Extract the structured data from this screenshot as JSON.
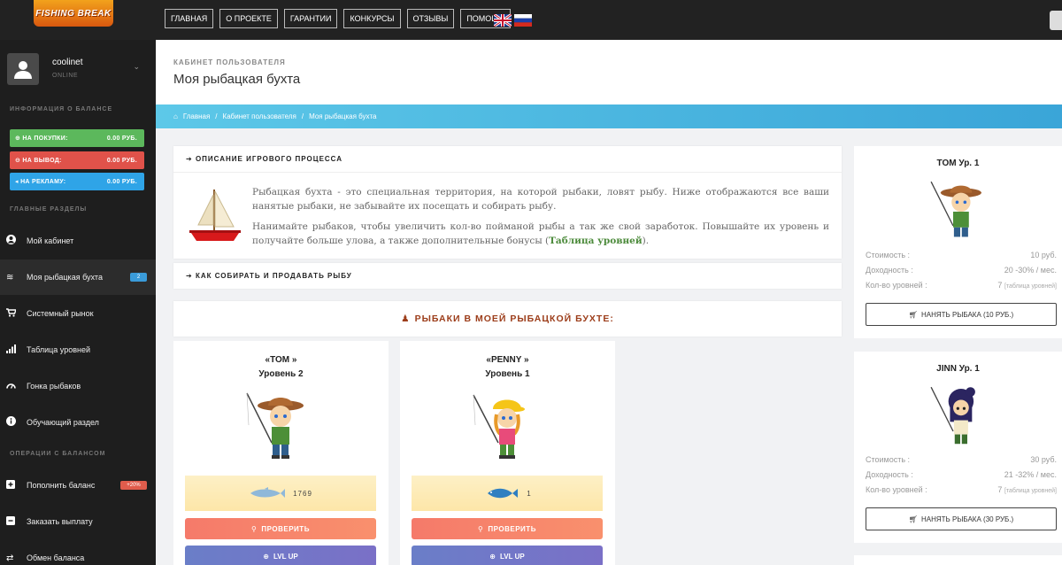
{
  "logo": {
    "text": "FISHING BREAK"
  },
  "nav": [
    "ГЛАВНАЯ",
    "О ПРОЕКТЕ",
    "ГАРАНТИИ",
    "КОНКУРСЫ",
    "ОТЗЫВЫ",
    "ПОМОЩЬ"
  ],
  "user": {
    "name": "coolinet",
    "status": "ONLINE"
  },
  "sidebar": {
    "balance_header": "ИНФОРМАЦИЯ О БАЛАНСЕ",
    "balances": [
      {
        "label": "НА ПОКУПКИ:",
        "value": "0.00 РУБ.",
        "color": "#5cb85c"
      },
      {
        "label": "НА ВЫВОД:",
        "value": "0.00 РУБ.",
        "color": "#e0524a"
      },
      {
        "label": "НА РЕКЛАМУ:",
        "value": "0.00 РУБ.",
        "color": "#2fa4e7"
      }
    ],
    "main_header": "ГЛАВНЫЕ РАЗДЕЛЫ",
    "main_items": [
      {
        "label": "Мой кабинет",
        "icon": "user-icon"
      },
      {
        "label": "Моя рыбацкая бухта",
        "icon": "fish-icon",
        "badge": "2"
      },
      {
        "label": "Системный рынок",
        "icon": "cart-icon"
      },
      {
        "label": "Таблица уровней",
        "icon": "bar-chart-icon"
      },
      {
        "label": "Гонка рыбаков",
        "icon": "gauge-icon"
      },
      {
        "label": "Обучающий раздел",
        "icon": "info-icon"
      }
    ],
    "ops_header": "ОПЕРАЦИИ С БАЛАНСОМ",
    "ops_items": [
      {
        "label": "Пополнить баланс",
        "icon": "plus-square-icon",
        "badge": "+20%"
      },
      {
        "label": "Заказать выплату",
        "icon": "minus-square-icon"
      },
      {
        "label": "Обмен баланса",
        "icon": "exchange-icon"
      }
    ]
  },
  "page": {
    "subtitle": "КАБИНЕТ ПОЛЬЗОВАТЕЛЯ",
    "title": "Моя рыбацкая бухта"
  },
  "breadcrumb": [
    "Главная",
    "Кабинет пользователя",
    "Моя рыбацкая бухта"
  ],
  "description": {
    "header": "ОПИСАНИЕ ИГРОВОГО ПРОЦЕССА",
    "p1": "Рыбацкая бухта - это специальная территория, на которой рыбаки, ловят рыбу. Ниже отображаются все ваши нанятые рыбаки, не забывайте их посещать и собирать рыбу.",
    "p2a": "Нанимайте рыбаков, чтобы увеличить кол-во пойманой рыбы а так же свой заработок. Повышайте их уровень и получайте больше улова, а также дополнительные бонусы (",
    "p2link": "Таблица уровней",
    "p2b": ")."
  },
  "howto": {
    "header": "КАК СОБИРАТЬ И ПРОДАВАТЬ РЫБУ"
  },
  "fishers_header": "РЫБАКИ В МОЕЙ РЫБАЦКОЙ БУХТЕ:",
  "fishers": [
    {
      "name": "«TOM »",
      "level": "Уровень 2",
      "fish": "1769",
      "check": "ПРОВЕРИТЬ",
      "lvlup": "LVL UP"
    },
    {
      "name": "«PENNY »",
      "level": "Уровень 1",
      "fish": "1",
      "check": "ПРОВЕРИТЬ",
      "lvlup": "LVL UP"
    }
  ],
  "shop": [
    {
      "title": "TOM Ур. 1",
      "cost_label": "Стоимость :",
      "cost": "10 руб.",
      "income_label": "Доходность :",
      "income": "20 -30% / мес.",
      "levels_label": "Кол-во уровней :",
      "levels": "7",
      "levels_note": "[таблица уровней]",
      "button": "НАНЯТЬ РЫБАКА (10 РУБ.)"
    },
    {
      "title": "JINN Ур. 1",
      "cost_label": "Стоимость :",
      "cost": "30 руб.",
      "income_label": "Доходность :",
      "income": "21 -32% / мес.",
      "levels_label": "Кол-во уровней :",
      "levels": "7",
      "levels_note": "[таблица уровней]",
      "button": "НАНЯТЬ РЫБАКА (30 РУБ.)"
    }
  ]
}
